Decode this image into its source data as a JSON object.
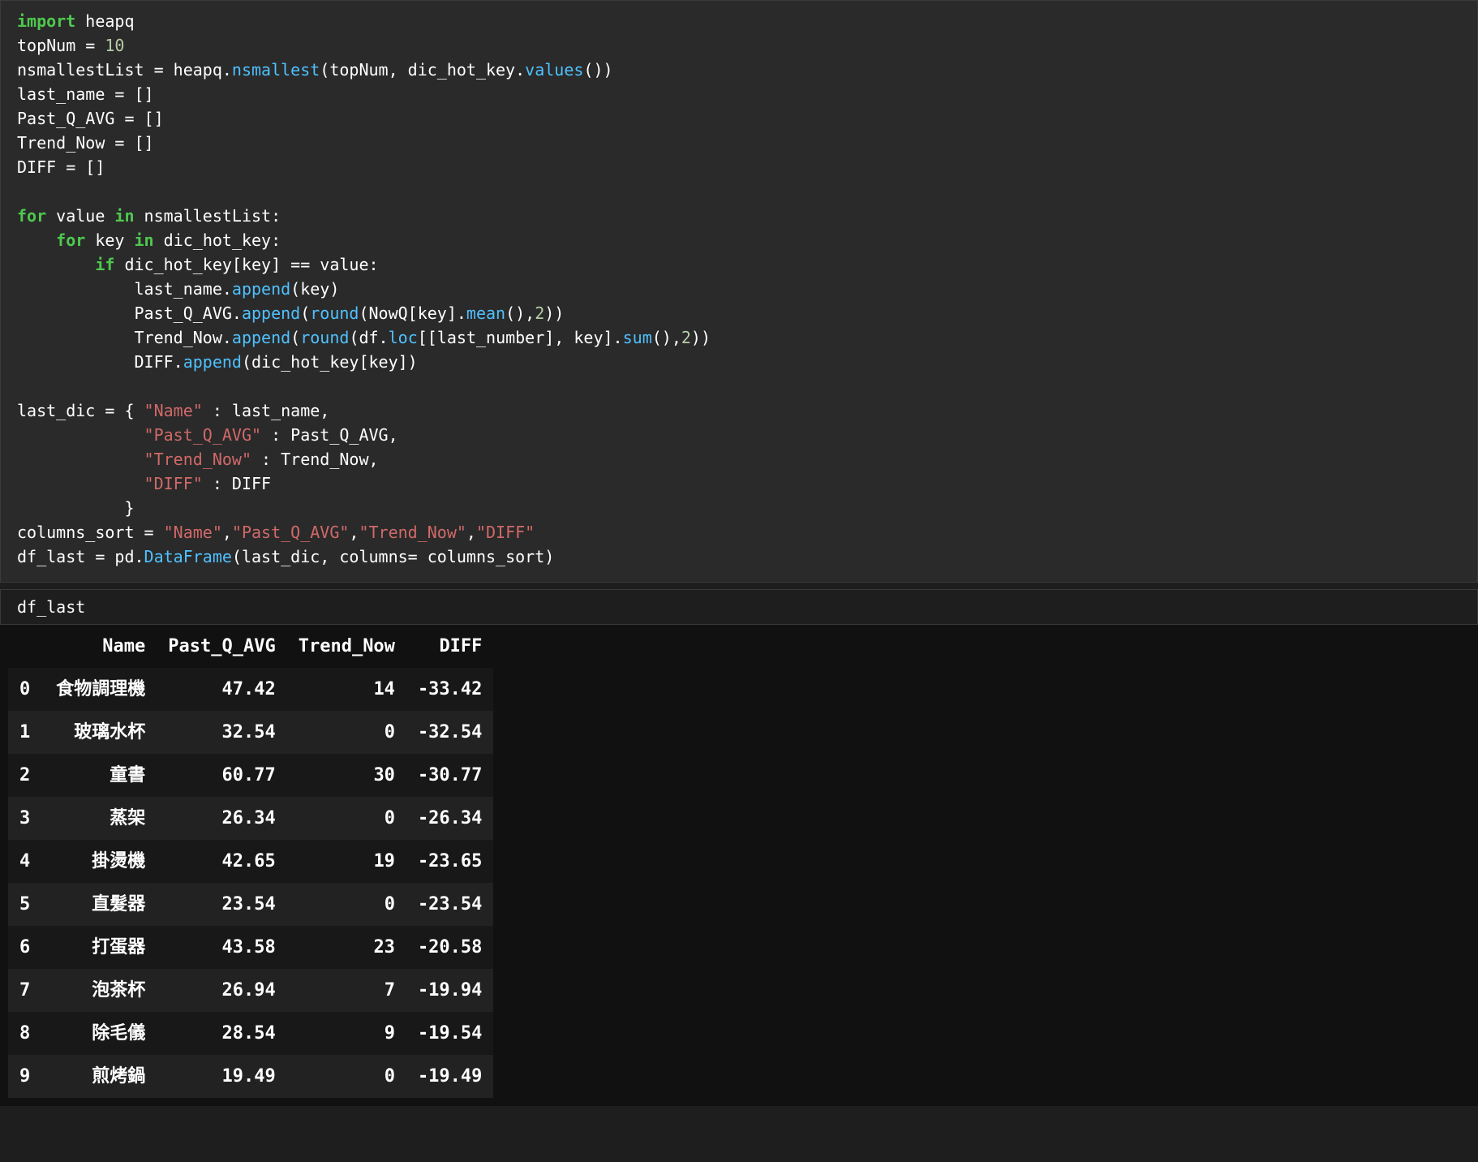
{
  "code": {
    "l1_import": "import",
    "l1_heapq": " heapq",
    "l2_a": "topNum = ",
    "l2_num": "10",
    "l3_a": "nsmallestList = heapq.",
    "l3_fn": "nsmallest",
    "l3_b": "(topNum, dic_hot_key.",
    "l3_fn2": "values",
    "l3_c": "())",
    "l4": "last_name = []",
    "l5": "Past_Q_AVG = []",
    "l6": "Trend_Now = []",
    "l7": "DIFF = []",
    "blank1": "",
    "l8_for": "for",
    "l8_a": " value ",
    "l8_in": "in",
    "l8_b": " nsmallestList:",
    "l9_pad": "    ",
    "l9_for": "for",
    "l9_a": " key ",
    "l9_in": "in",
    "l9_b": " dic_hot_key:",
    "l10_pad": "        ",
    "l10_if": "if",
    "l10_a": " dic_hot_key[key] == value:",
    "l11_pad": "            ",
    "l11_a": "last_name.",
    "l11_fn": "append",
    "l11_b": "(key)",
    "l12_pad": "            ",
    "l12_a": "Past_Q_AVG.",
    "l12_fn": "append",
    "l12_b": "(",
    "l12_fn2": "round",
    "l12_c": "(NowQ[key].",
    "l12_fn3": "mean",
    "l12_d": "(),",
    "l12_num": "2",
    "l12_e": "))",
    "l13_pad": "            ",
    "l13_a": "Trend_Now.",
    "l13_fn": "append",
    "l13_b": "(",
    "l13_fn2": "round",
    "l13_c": "(df.",
    "l13_loc": "loc",
    "l13_d": "[[last_number], key].",
    "l13_fn3": "sum",
    "l13_e": "(),",
    "l13_num": "2",
    "l13_f": "))",
    "l14_pad": "            ",
    "l14_a": "DIFF.",
    "l14_fn": "append",
    "l14_b": "(dic_hot_key[key])",
    "blank2": "",
    "l15_a": "last_dic = { ",
    "l15_s1": "\"Name\"",
    "l15_b": " : last_name,",
    "l16_pad": "             ",
    "l16_s": "\"Past_Q_AVG\"",
    "l16_b": " : Past_Q_AVG,",
    "l17_pad": "             ",
    "l17_s": "\"Trend_Now\"",
    "l17_b": " : Trend_Now,",
    "l18_pad": "             ",
    "l18_s": "\"DIFF\"",
    "l18_b": " : DIFF",
    "l19_pad": "           ",
    "l19_a": "}",
    "l20_a": "columns_sort = ",
    "l20_s1": "\"Name\"",
    "l20_c": ",",
    "l20_s2": "\"Past_Q_AVG\"",
    "l20_s3": "\"Trend_Now\"",
    "l20_s4": "\"DIFF\"",
    "l21_a": "df_last = pd.",
    "l21_fn": "DataFrame",
    "l21_b": "(last_dic, columns= columns_sort)"
  },
  "code2": {
    "l1": "df_last"
  },
  "table": {
    "headers": [
      "",
      "Name",
      "Past_Q_AVG",
      "Trend_Now",
      "DIFF"
    ],
    "rows": [
      {
        "idx": "0",
        "name": "食物調理機",
        "past": "47.42",
        "trend": "14",
        "diff": "-33.42"
      },
      {
        "idx": "1",
        "name": "玻璃水杯",
        "past": "32.54",
        "trend": "0",
        "diff": "-32.54"
      },
      {
        "idx": "2",
        "name": "童書",
        "past": "60.77",
        "trend": "30",
        "diff": "-30.77"
      },
      {
        "idx": "3",
        "name": "蒸架",
        "past": "26.34",
        "trend": "0",
        "diff": "-26.34"
      },
      {
        "idx": "4",
        "name": "掛燙機",
        "past": "42.65",
        "trend": "19",
        "diff": "-23.65"
      },
      {
        "idx": "5",
        "name": "直髮器",
        "past": "23.54",
        "trend": "0",
        "diff": "-23.54"
      },
      {
        "idx": "6",
        "name": "打蛋器",
        "past": "43.58",
        "trend": "23",
        "diff": "-20.58"
      },
      {
        "idx": "7",
        "name": "泡茶杯",
        "past": "26.94",
        "trend": "7",
        "diff": "-19.94"
      },
      {
        "idx": "8",
        "name": "除毛儀",
        "past": "28.54",
        "trend": "9",
        "diff": "-19.54"
      },
      {
        "idx": "9",
        "name": "煎烤鍋",
        "past": "19.49",
        "trend": "0",
        "diff": "-19.49"
      }
    ]
  },
  "chart_data": {
    "type": "table",
    "title": "df_last",
    "columns": [
      "Name",
      "Past_Q_AVG",
      "Trend_Now",
      "DIFF"
    ],
    "rows": [
      [
        "食物調理機",
        47.42,
        14,
        -33.42
      ],
      [
        "玻璃水杯",
        32.54,
        0,
        -32.54
      ],
      [
        "童書",
        60.77,
        30,
        -30.77
      ],
      [
        "蒸架",
        26.34,
        0,
        -26.34
      ],
      [
        "掛燙機",
        42.65,
        19,
        -23.65
      ],
      [
        "直髮器",
        23.54,
        0,
        -23.54
      ],
      [
        "打蛋器",
        43.58,
        23,
        -20.58
      ],
      [
        "泡茶杯",
        26.94,
        7,
        -19.94
      ],
      [
        "除毛儀",
        28.54,
        9,
        -19.54
      ],
      [
        "煎烤鍋",
        19.49,
        0,
        -19.49
      ]
    ]
  }
}
